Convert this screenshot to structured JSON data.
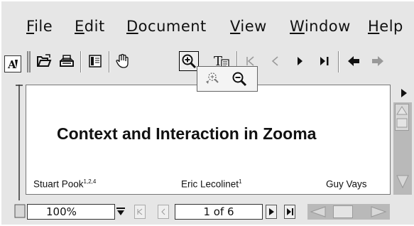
{
  "menu": {
    "items": [
      {
        "underlined": "F",
        "rest": "ile"
      },
      {
        "underlined": "E",
        "rest": "dit"
      },
      {
        "underlined": "D",
        "rest": "ocument"
      },
      {
        "underlined": "V",
        "rest": "iew"
      },
      {
        "underlined": "W",
        "rest": "indow"
      },
      {
        "underlined": "H",
        "rest": "elp"
      }
    ]
  },
  "toolbar": {
    "icons": [
      "acrobat-icon",
      "open-folder-icon",
      "print-icon",
      "show-hide-navigation-icon",
      "hand-tool-icon",
      "zoom-in-icon",
      "text-select-icon",
      "first-page-icon",
      "previous-page-icon",
      "next-page-icon",
      "last-page-icon",
      "go-back-icon",
      "go-forward-icon"
    ],
    "text_tool_label": "T"
  },
  "zoom_palette": {
    "icons": [
      "zoom-in-tool-icon",
      "zoom-out-tool-icon"
    ]
  },
  "document": {
    "title": "Context and Interaction in Zooma",
    "authors": [
      {
        "name": "Stuart Pook",
        "sup": "1,2,4"
      },
      {
        "name": "Eric Lecolinet",
        "sup": "1"
      },
      {
        "name": "Guy Vays",
        "sup": ""
      }
    ]
  },
  "status": {
    "zoom": "100%",
    "page": "1 of 6"
  },
  "colors": {
    "chrome": "#e6e6e6",
    "scrollbar_track": "#b9b9b9",
    "page": "#ffffff"
  }
}
